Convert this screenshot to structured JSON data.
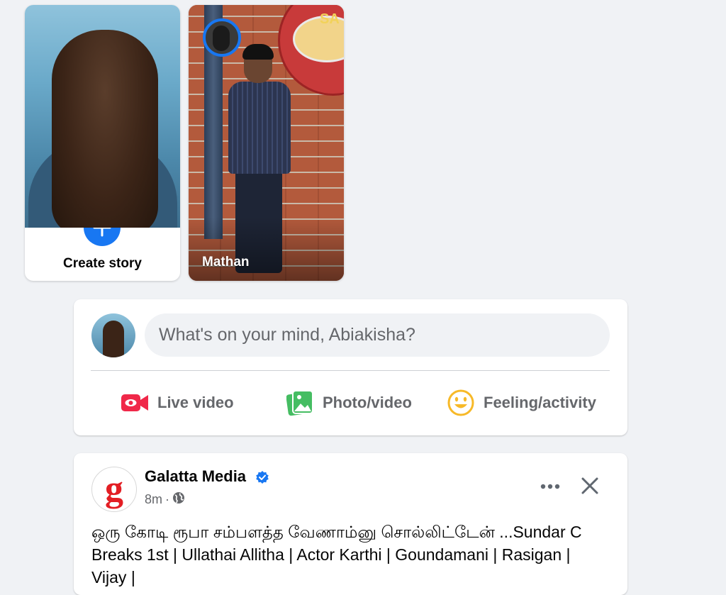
{
  "stories": {
    "create_label": "Create story",
    "friend_name": "Mathan",
    "friend_sign_text": "SA"
  },
  "composer": {
    "placeholder": "What's on your mind, Abiakisha?",
    "actions": [
      {
        "label": "Live video",
        "icon": "live-video-icon",
        "color": "#f02849"
      },
      {
        "label": "Photo/video",
        "icon": "photo-video-icon",
        "color": "#45bd62"
      },
      {
        "label": "Feeling/activity",
        "icon": "feeling-icon",
        "color": "#f7b928"
      }
    ]
  },
  "post": {
    "page_name": "Galatta Media",
    "logo_letter": "g",
    "time": "8m",
    "separator": "·",
    "text": "ஒரு கோடி ரூபா சம்பளத்த வேணாம்னு சொல்லிட்டேன் ...Sundar C Breaks 1st | Ullathai Allitha | Actor Karthi | Goundamani | Rasigan | Vijay |"
  },
  "colors": {
    "accent": "#1877f2",
    "page_bg": "#f0f2f5",
    "secondary_text": "#65676b"
  }
}
